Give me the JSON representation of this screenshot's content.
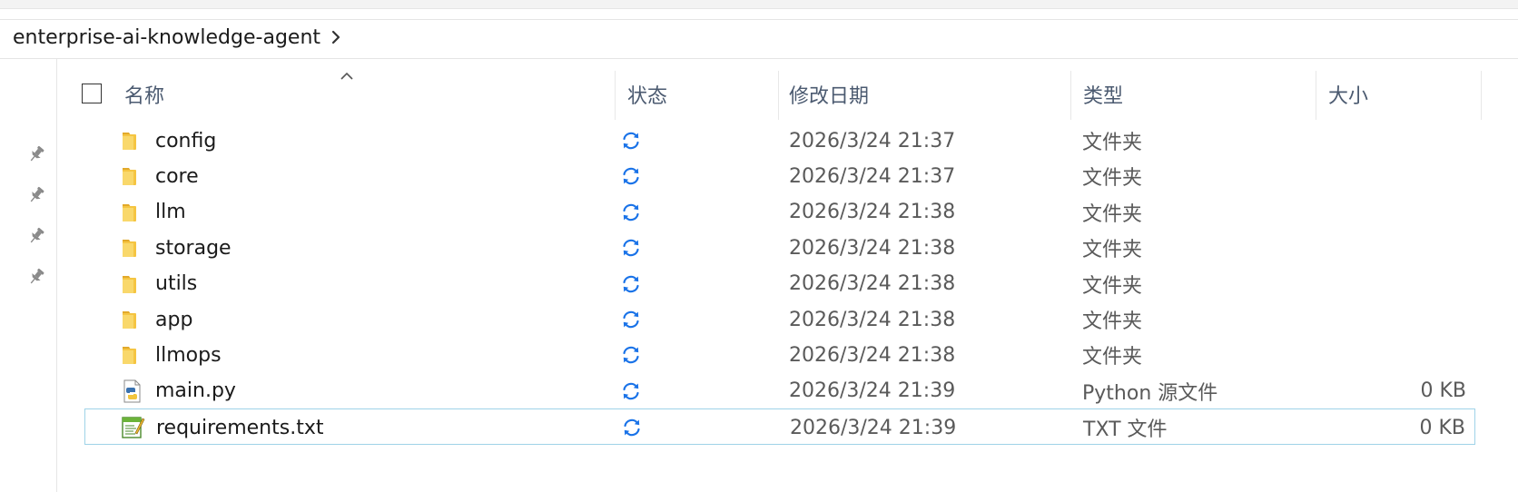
{
  "breadcrumb": {
    "folder": "enterprise-ai-knowledge-agent",
    "chevron_icon": "chevron-right-icon"
  },
  "columns": {
    "name": "名称",
    "status": "状态",
    "modified": "修改日期",
    "type": "类型",
    "size": "大小"
  },
  "sort": {
    "column": "name",
    "direction": "ascending",
    "icon": "sort-up-caret-icon"
  },
  "quick_access_pins": [
    "pin-icon",
    "pin-icon",
    "pin-icon",
    "pin-icon"
  ],
  "files": [
    {
      "name": "config",
      "icon": "folder-icon",
      "status_icon": "sync-icon",
      "modified": "2026/3/24 21:37",
      "type": "文件夹",
      "size": ""
    },
    {
      "name": "core",
      "icon": "folder-icon",
      "status_icon": "sync-icon",
      "modified": "2026/3/24 21:37",
      "type": "文件夹",
      "size": ""
    },
    {
      "name": "llm",
      "icon": "folder-icon",
      "status_icon": "sync-icon",
      "modified": "2026/3/24 21:38",
      "type": "文件夹",
      "size": ""
    },
    {
      "name": "storage",
      "icon": "folder-icon",
      "status_icon": "sync-icon",
      "modified": "2026/3/24 21:38",
      "type": "文件夹",
      "size": ""
    },
    {
      "name": "utils",
      "icon": "folder-icon",
      "status_icon": "sync-icon",
      "modified": "2026/3/24 21:38",
      "type": "文件夹",
      "size": ""
    },
    {
      "name": "app",
      "icon": "folder-icon",
      "status_icon": "sync-icon",
      "modified": "2026/3/24 21:38",
      "type": "文件夹",
      "size": ""
    },
    {
      "name": "llmops",
      "icon": "folder-icon",
      "status_icon": "sync-icon",
      "modified": "2026/3/24 21:38",
      "type": "文件夹",
      "size": ""
    },
    {
      "name": "main.py",
      "icon": "python-file-icon",
      "status_icon": "sync-icon",
      "modified": "2026/3/24 21:39",
      "type": "Python 源文件",
      "size": "0 KB"
    },
    {
      "name": "requirements.txt",
      "icon": "text-file-icon",
      "status_icon": "sync-icon",
      "modified": "2026/3/24 21:39",
      "type": "TXT 文件",
      "size": "0 KB",
      "selected": true
    }
  ],
  "colors": {
    "accent_sync": "#1a73e8",
    "folder": "#f5c542",
    "selection_border": "#9fd3e8",
    "header_text": "#4b5a70"
  }
}
